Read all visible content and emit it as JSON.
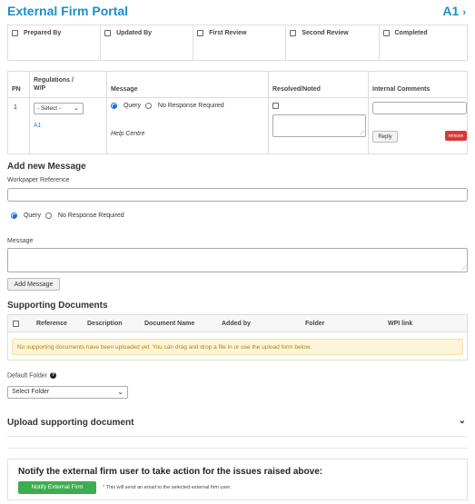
{
  "header": {
    "title": "External Firm Portal",
    "nav_label": "A1",
    "nav_icon": "chevron-right-icon"
  },
  "signoff": [
    "Prepared By",
    "Updated By",
    "First Review",
    "Second Review",
    "Completed"
  ],
  "messages_table": {
    "headers": {
      "pn": "PN",
      "regulations": "Regulations / W/P",
      "message": "Message",
      "resolved": "Resolved/Noted",
      "internal": "Internal Comments"
    },
    "row": {
      "pn": "1",
      "select_value": "- Select -",
      "wp_link": "A1",
      "radio_query": "Query",
      "radio_no_response": "No Response Required",
      "help_link": "Help Centre",
      "reply_label": "Reply",
      "remove_label": "remove"
    }
  },
  "add_message": {
    "heading": "Add new Message",
    "wp_ref_label": "Workpaper Reference",
    "radio_query": "Query",
    "radio_no_response": "No Response Required",
    "message_label": "Message",
    "button": "Add Message"
  },
  "supporting": {
    "heading": "Supporting Documents",
    "columns": [
      "Reference",
      "Description",
      "Document Name",
      "Added by",
      "Folder",
      "WPI link"
    ],
    "empty_text": "No supporting documents have been uploaded yet. You can drag and drop a file in or use the upload form below.",
    "default_folder_label": "Default Folder",
    "folder_select": "Select Folder"
  },
  "upload": {
    "heading": "Upload supporting document"
  },
  "notify": {
    "heading": "Notify the external firm user to take action for the issues raised above:",
    "button": "Notify External Firm",
    "note_star": "*",
    "note": "This will send an email to the selected external firm user."
  },
  "colors": {
    "accent": "#1a8fc9",
    "success": "#3cae4f",
    "danger": "#d9393a",
    "warning_bg": "#fdf5d8",
    "warning_text": "#b47e15"
  }
}
